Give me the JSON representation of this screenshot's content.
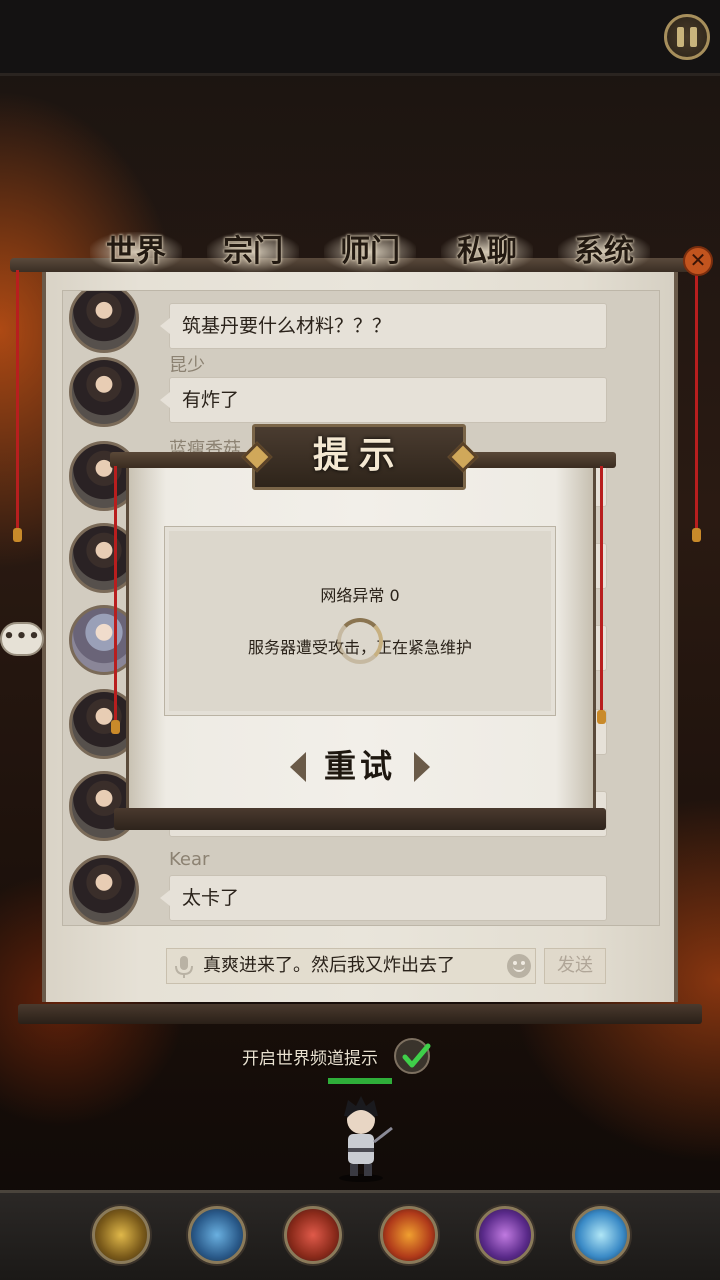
{
  "tabs": [
    "世界",
    "宗门",
    "师门",
    "私聊",
    "系统"
  ],
  "chat": {
    "messages": [
      {
        "sender": "",
        "text": "筑基丹要什么材料？？？"
      },
      {
        "sender": "昆少",
        "text": "有炸了"
      },
      {
        "sender": "蓝瘦香菇",
        "text": ""
      },
      {
        "sender": "",
        "text": ""
      },
      {
        "sender": "",
        "text": ""
      },
      {
        "sender": "",
        "text": ""
      },
      {
        "sender": "",
        "text": ""
      },
      {
        "sender": "Kear",
        "text": "太卡了"
      }
    ],
    "input_value": "真爽进来了。然后我又炸出去了",
    "send_label": "发送"
  },
  "side_bubble": "•••",
  "world_channel": {
    "label": "开启世界频道提示",
    "enabled": true
  },
  "dialog": {
    "title": "提示",
    "message_line1": "网络异常 0",
    "message_line2": "服务器遭受攻击，正在紧急维护",
    "retry_label": "重试"
  },
  "close_symbol": "✕",
  "icons": {
    "pause": "pause-icon",
    "mic": "microphone-icon",
    "emoji": "emoji-icon",
    "check": "checkmark-icon",
    "skills": [
      "scroll-skill-icon",
      "blue-blade-skill-icon",
      "red-banner-skill-icon",
      "flame-skill-icon",
      "purple-vortex-skill-icon",
      "ice-crystal-skill-icon"
    ]
  },
  "colors": {
    "accent_green": "#2fae3a",
    "close_orange": "#c2541e",
    "tassel_red": "#b81e1e"
  }
}
